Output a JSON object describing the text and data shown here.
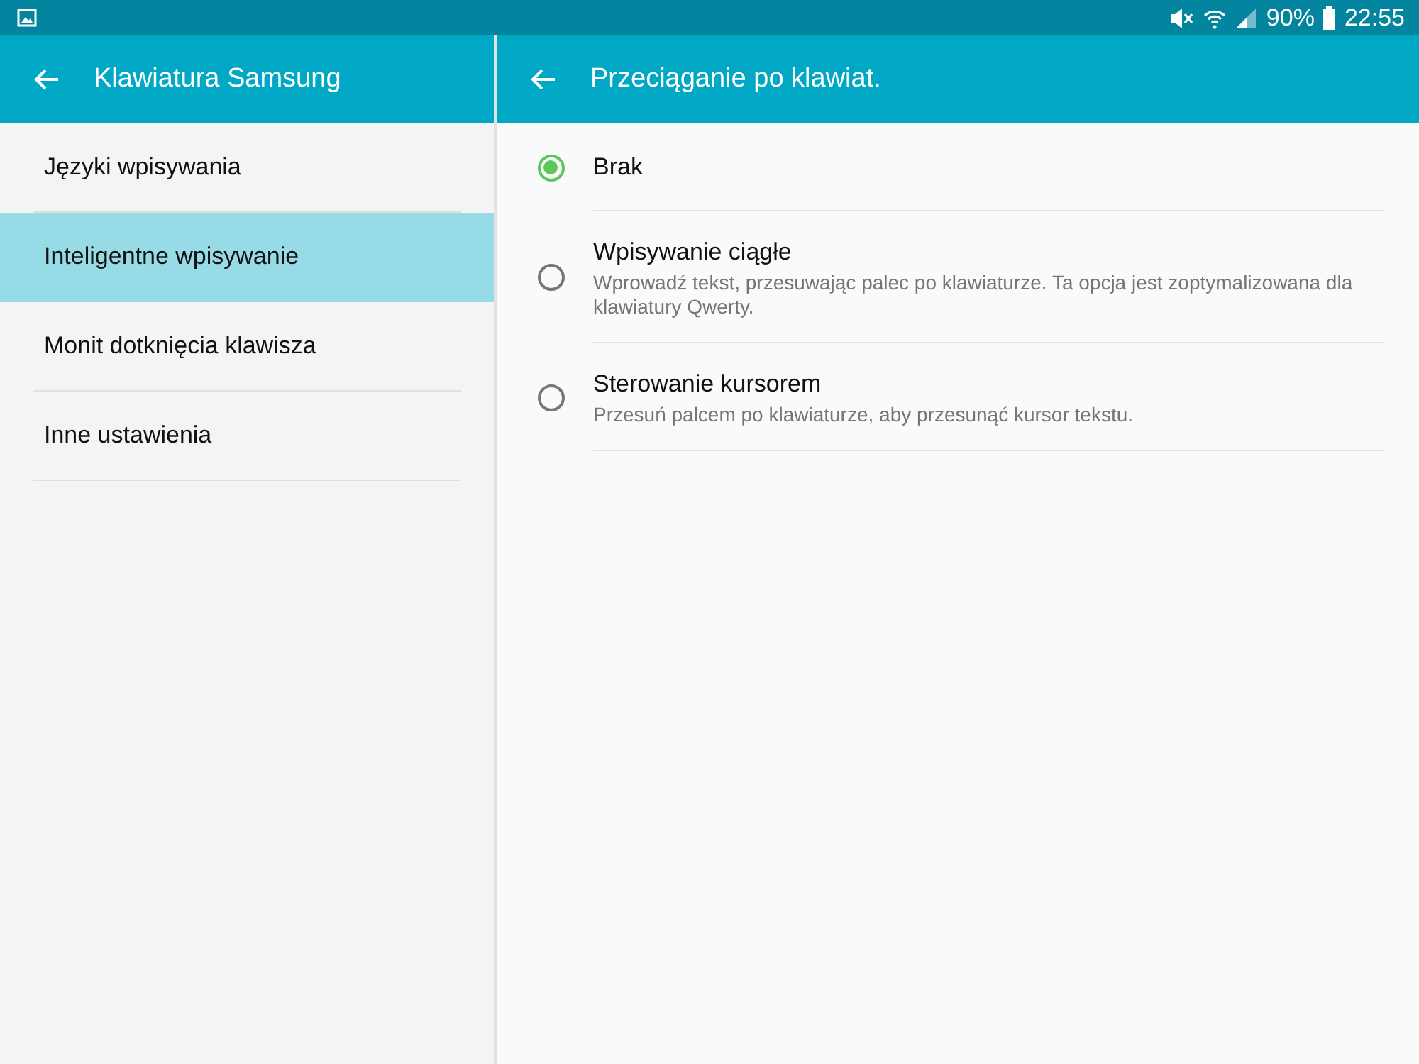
{
  "status_bar": {
    "battery": "90%",
    "time": "22:55"
  },
  "left_panel": {
    "title": "Klawiatura Samsung",
    "items": [
      {
        "label": "Języki wpisywania",
        "selected": false
      },
      {
        "label": "Inteligentne wpisywanie",
        "selected": true
      },
      {
        "label": "Monit dotknięcia klawisza",
        "selected": false
      },
      {
        "label": "Inne ustawienia",
        "selected": false
      }
    ]
  },
  "right_panel": {
    "title": "Przeciąganie po klawiat.",
    "options": [
      {
        "label": "Brak",
        "selected": true
      },
      {
        "label": "Wpisywanie ciągłe",
        "description": "Wprowadź tekst, przesuwając palec po klawiaturze. Ta opcja jest zoptymalizowana dla klawiatury Qwerty.",
        "selected": false
      },
      {
        "label": "Sterowanie kursorem",
        "description": "Przesuń palcem po klawiaturze, aby przesunąć kursor tekstu.",
        "selected": false
      }
    ]
  }
}
